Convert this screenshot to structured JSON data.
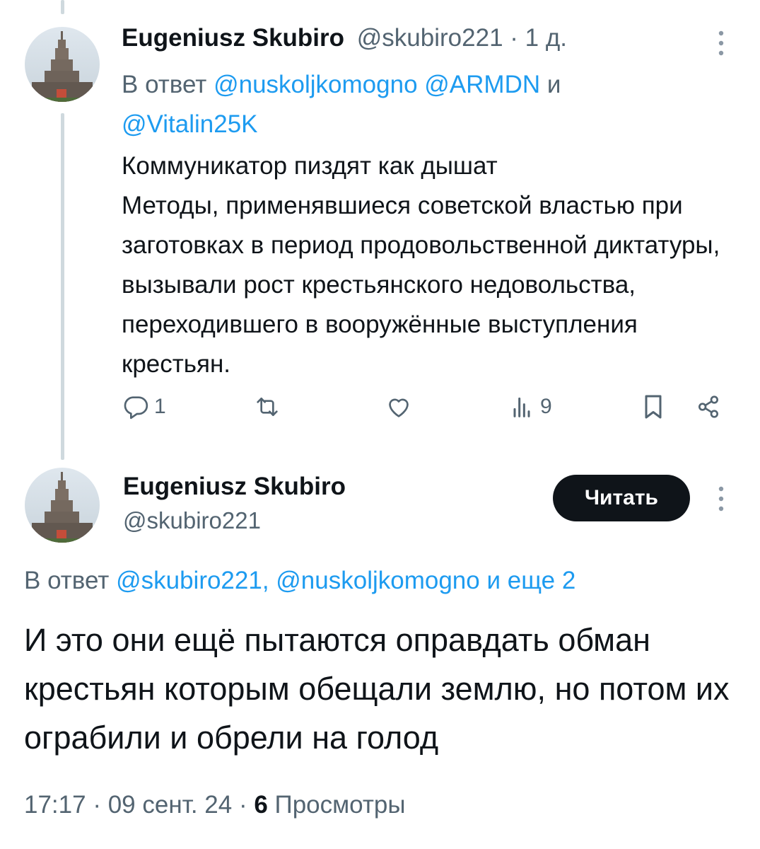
{
  "tweet1": {
    "author_name": "Eugeniusz Skubiro",
    "author_handle": "@skubiro221",
    "separator": "·",
    "time": "1 д.",
    "reply_prefix": "В ответ",
    "reply_mention_1": "@nuskoljkomogno",
    "reply_mention_2": "@ARMDN",
    "reply_and": "и",
    "reply_mention_3": "@Vitalin25K",
    "text": "Коммуникатор пиздят как дышат\nМетоды, применявшиеся советской властью при заготовках в период продовольственной диктатуры, вызывали рост крестьянского недовольства, переходившего в вооружённые выступления крестьян.",
    "actions": {
      "reply_count": "1",
      "retweet_count": "",
      "like_count": "",
      "views_count": "9"
    },
    "icons": [
      "more-icon",
      "reply-icon",
      "retweet-icon",
      "like-icon",
      "views-icon",
      "bookmark-icon",
      "share-icon"
    ]
  },
  "tweet2": {
    "author_name": "Eugeniusz Skubiro",
    "author_handle": "@skubiro221",
    "follow_label": "Читать",
    "reply_prefix": "В ответ",
    "reply_mentions": "@skubiro221, @nuskoljkomogno",
    "reply_suffix": "и еще 2",
    "text": "И это они ещё пытаются оправдать обман крестьян которым обещали землю, но потом их ограбили и обрели на голод",
    "time": "17:17",
    "date": "09 сент. 24",
    "separator": "·",
    "views_count": "6",
    "views_label": "Просмотры"
  },
  "colors": {
    "text": "#0f1419",
    "muted": "#536471",
    "link": "#1d9bf0",
    "thread_line": "#cfd9de",
    "button_bg": "#0f1419",
    "button_text": "#ffffff"
  }
}
